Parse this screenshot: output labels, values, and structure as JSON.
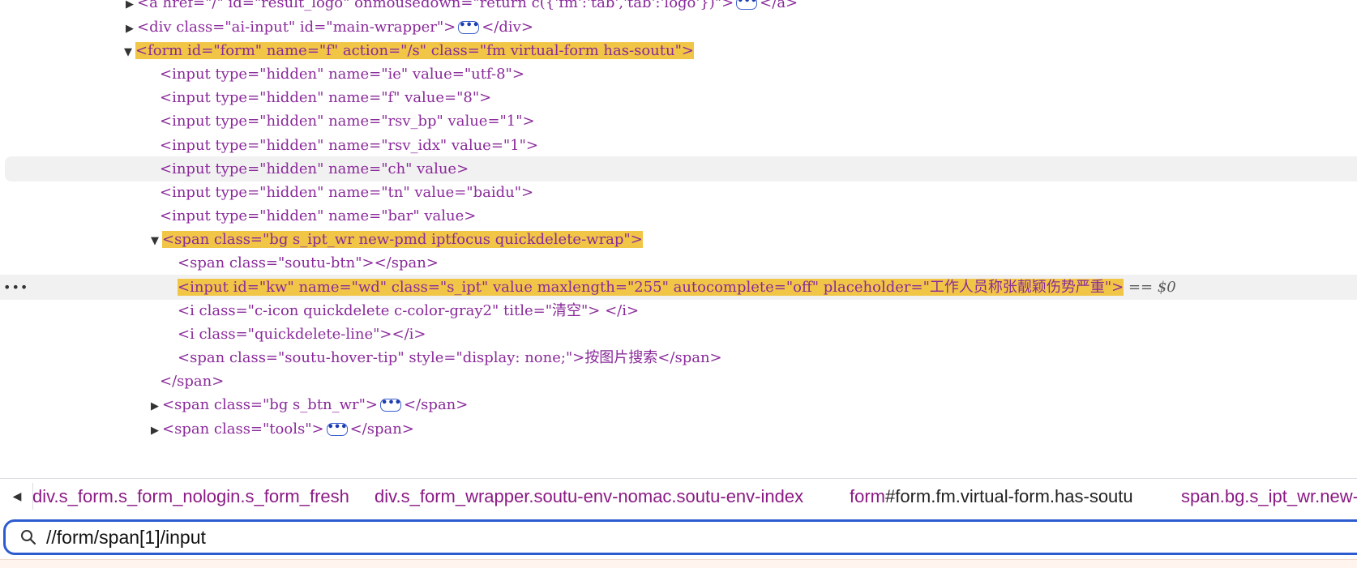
{
  "elements_tree": {
    "gutter_dots": "•••",
    "selected_suffix": "== $0",
    "lines": [
      {
        "text_a": "<a href=\"/\" id=\"result_logo\" onmousedown=\"return c({'fm':'tab','tab':'logo'})\">",
        "text_b": "</a>"
      },
      {
        "text_a": "<div class=\"ai-input\" id=\"main-wrapper\">",
        "text_b": "</div>"
      },
      {
        "text_a": "<form id=\"form\" name=\"f\" action=\"/s\" class=\"fm  virtual-form has-soutu\">"
      },
      {
        "text_a": "<input type=\"hidden\" name=\"ie\" value=\"utf-8\">"
      },
      {
        "text_a": "<input type=\"hidden\" name=\"f\" value=\"8\">"
      },
      {
        "text_a": "<input type=\"hidden\" name=\"rsv_bp\" value=\"1\">"
      },
      {
        "text_a": "<input type=\"hidden\" name=\"rsv_idx\" value=\"1\">"
      },
      {
        "text_a": "<input type=\"hidden\" name=\"ch\" value>"
      },
      {
        "text_a": "<input type=\"hidden\" name=\"tn\" value=\"baidu\">"
      },
      {
        "text_a": "<input type=\"hidden\" name=\"bar\" value>"
      },
      {
        "text_a": "<span class=\"bg s_ipt_wr new-pmd iptfocus quickdelete-wrap\">"
      },
      {
        "text_a": "<span class=\"soutu-btn\"></span>"
      },
      {
        "text_a": "<input id=\"kw\" name=\"wd\" class=\"s_ipt\" value maxlength=\"255\" autocomplete=\"off\" placeholder=\"工作人员称张靓颖伤势严重\">"
      },
      {
        "text_a": "<i class=\"c-icon quickdelete c-color-gray2\" title=\"清空\"> </i>"
      },
      {
        "text_a": "<i class=\"quickdelete-line\"></i>"
      },
      {
        "text_a": "<span class=\"soutu-hover-tip\" style=\"display: none;\">按图片搜索</span>"
      },
      {
        "text_a": "</span>"
      },
      {
        "text_a": "<span class=\"bg s_btn_wr\">",
        "text_b": "</span>"
      },
      {
        "text_a": "<span class=\"tools\">",
        "text_b": "</span>"
      }
    ]
  },
  "breadcrumbs": [
    {
      "tag": "div",
      "rest": ".s_form.s_form_nologin.s_form_fresh"
    },
    {
      "tag": "div",
      "rest": ".s_form_wrapper.soutu-env-nomac.soutu-env-index"
    },
    {
      "tag": "form",
      "rest": "#form.fm.virtual-form.has-soutu"
    },
    {
      "tag": "span",
      "rest": ".bg.s_ipt_wr.new-pmd"
    }
  ],
  "search": {
    "value": "//form/span[1]/input"
  },
  "colors": {
    "highlight": "#f1c646",
    "search_border": "#2d5bd0",
    "tag": "#8a2a9a",
    "attr_name": "#a8461a",
    "attr_value": "#1a2fa0"
  },
  "icons": {
    "search": "search-icon",
    "expand": "triangle-right-icon",
    "collapse": "triangle-down-icon",
    "back": "chevron-left-icon"
  }
}
